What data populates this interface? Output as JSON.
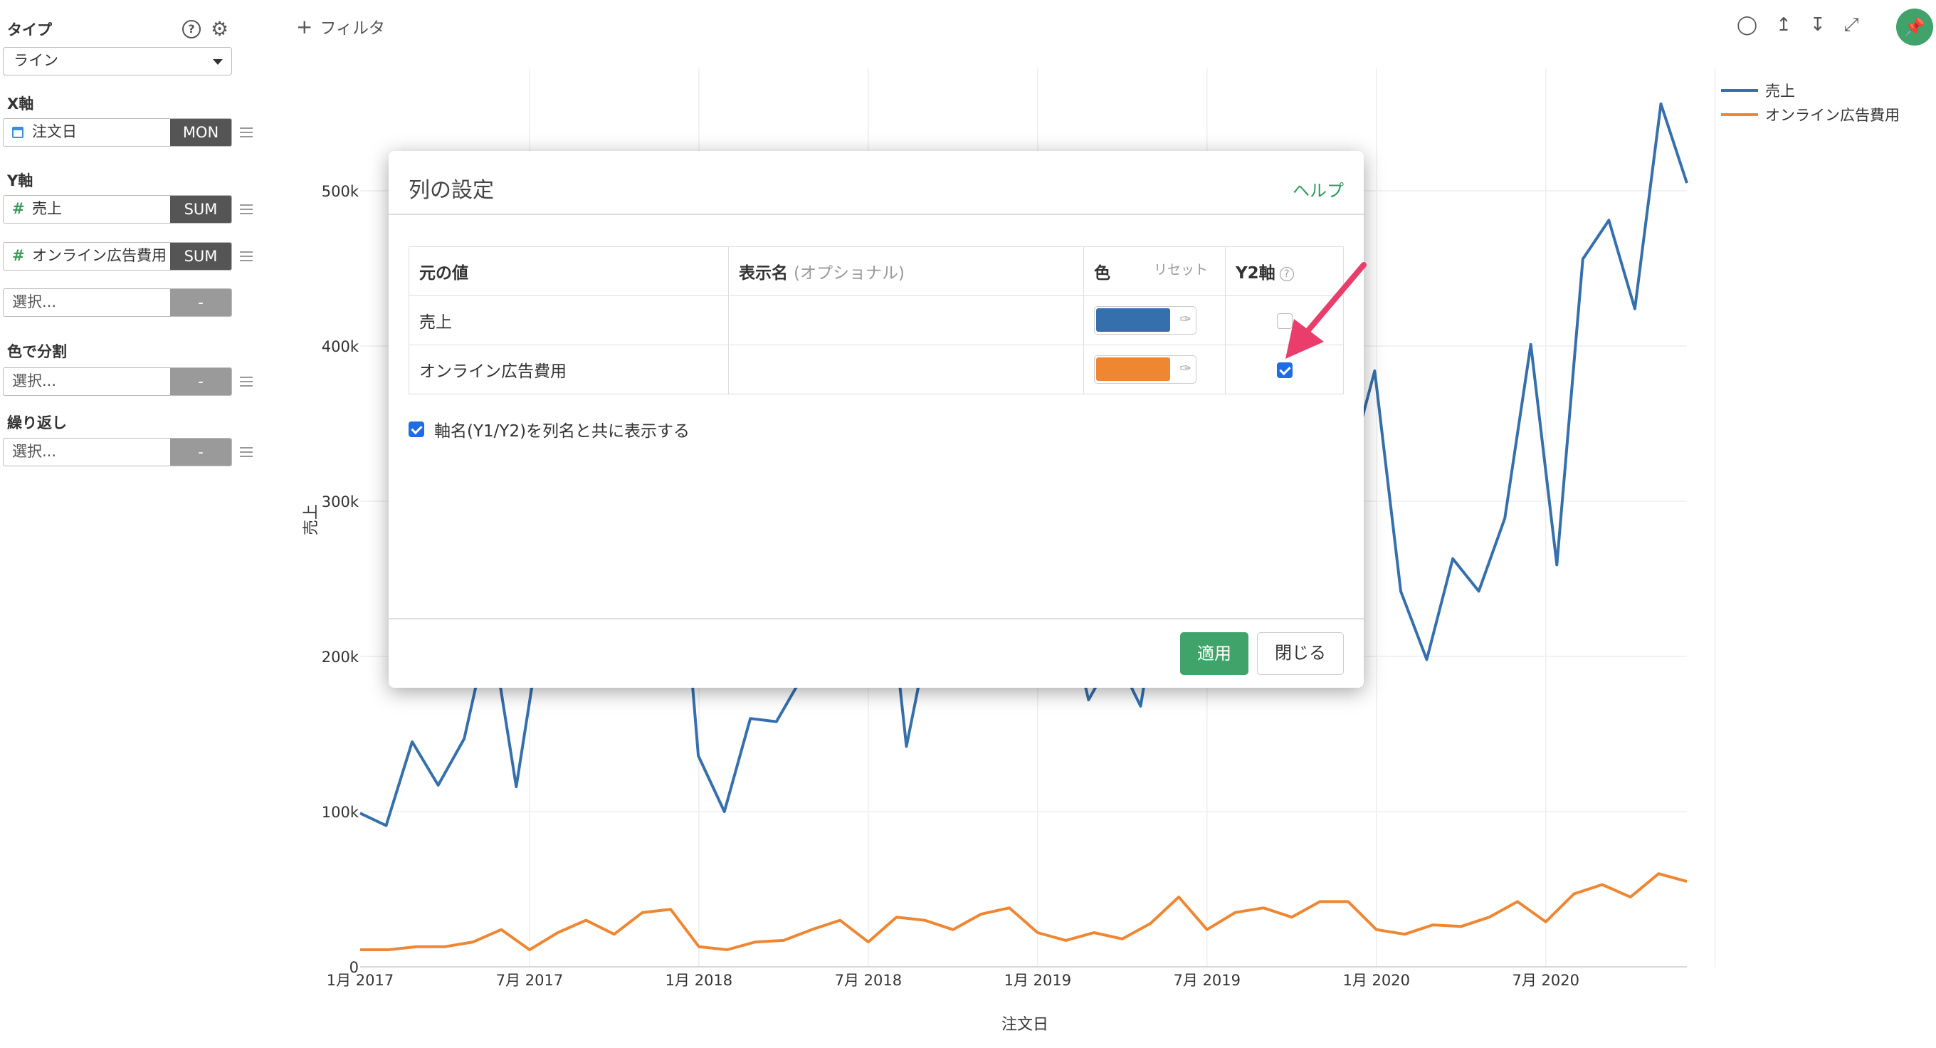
{
  "sidebar": {
    "type_label": "タイプ",
    "type_value": "ライン",
    "x_label": "X軸",
    "x_field": "注文日",
    "x_agg": "MON",
    "y_label": "Y軸",
    "y_fields": [
      {
        "name": "売上",
        "agg": "SUM"
      },
      {
        "name": "オンライン広告費用",
        "agg": "SUM"
      }
    ],
    "y_select_placeholder": "選択...",
    "y_select_agg": "-",
    "color_label": "色で分割",
    "color_placeholder": "選択...",
    "color_agg": "-",
    "repeat_label": "繰り返し",
    "repeat_placeholder": "選択...",
    "repeat_agg": "-"
  },
  "topbar": {
    "filter_label": "フィルタ"
  },
  "chart_data": {
    "type": "line",
    "xlabel": "注文日",
    "ylabel": "売上",
    "ylim": [
      0,
      550000
    ],
    "y_ticks": [
      "0",
      "100k",
      "200k",
      "300k",
      "400k",
      "500k"
    ],
    "x_ticks": [
      "1月 2017",
      "7月 2017",
      "1月 2018",
      "7月 2018",
      "1月 2019",
      "7月 2019",
      "1月 2020",
      "7月 2020"
    ],
    "series": [
      {
        "name": "売上",
        "color": "#3570ad",
        "values": [
          99000,
          91000,
          145000,
          117000,
          147000,
          222000,
          116000,
          223000,
          226000,
          254000,
          232000,
          281000,
          340000,
          136000,
          100000,
          160000,
          158000,
          187000,
          247000,
          232000,
          296000,
          142000,
          226000,
          222000,
          276000,
          247000,
          284000,
          243000,
          172000,
          202000,
          168000,
          271000,
          352000,
          315000,
          309000,
          362000,
          311000,
          326000,
          321000,
          384000,
          242000,
          198000,
          263000,
          242000,
          289000,
          401000,
          259000,
          456000,
          481000,
          424000,
          556000,
          505000
        ]
      },
      {
        "name": "オンライン広告費用",
        "color": "#ef8632",
        "values": [
          11000,
          11000,
          13000,
          13000,
          16000,
          24000,
          11000,
          22000,
          30000,
          21000,
          35000,
          37000,
          13000,
          11000,
          16000,
          17000,
          24000,
          30000,
          16000,
          32000,
          30000,
          24000,
          34000,
          38000,
          22000,
          17000,
          22000,
          18000,
          28000,
          45000,
          24000,
          35000,
          38000,
          32000,
          42000,
          42000,
          24000,
          21000,
          27000,
          26000,
          32000,
          42000,
          29000,
          47000,
          53000,
          45000,
          60000,
          55000
        ]
      }
    ],
    "legend": "top-right",
    "grid": true
  },
  "modal": {
    "title": "列の設定",
    "help": "ヘルプ",
    "headers": {
      "source": "元の値",
      "display": "表示名",
      "display_opt": "(オプショナル)",
      "color": "色",
      "reset": "リセット",
      "y2": "Y2軸"
    },
    "rows": [
      {
        "source": "売上",
        "display": "",
        "color": "#3570ad",
        "y2": false
      },
      {
        "source": "オンライン広告費用",
        "display": "",
        "color": "#ef8632",
        "y2": true
      }
    ],
    "show_axis_label": "軸名(Y1/Y2)を列名と共に表示する",
    "apply": "適用",
    "close": "閉じる"
  }
}
